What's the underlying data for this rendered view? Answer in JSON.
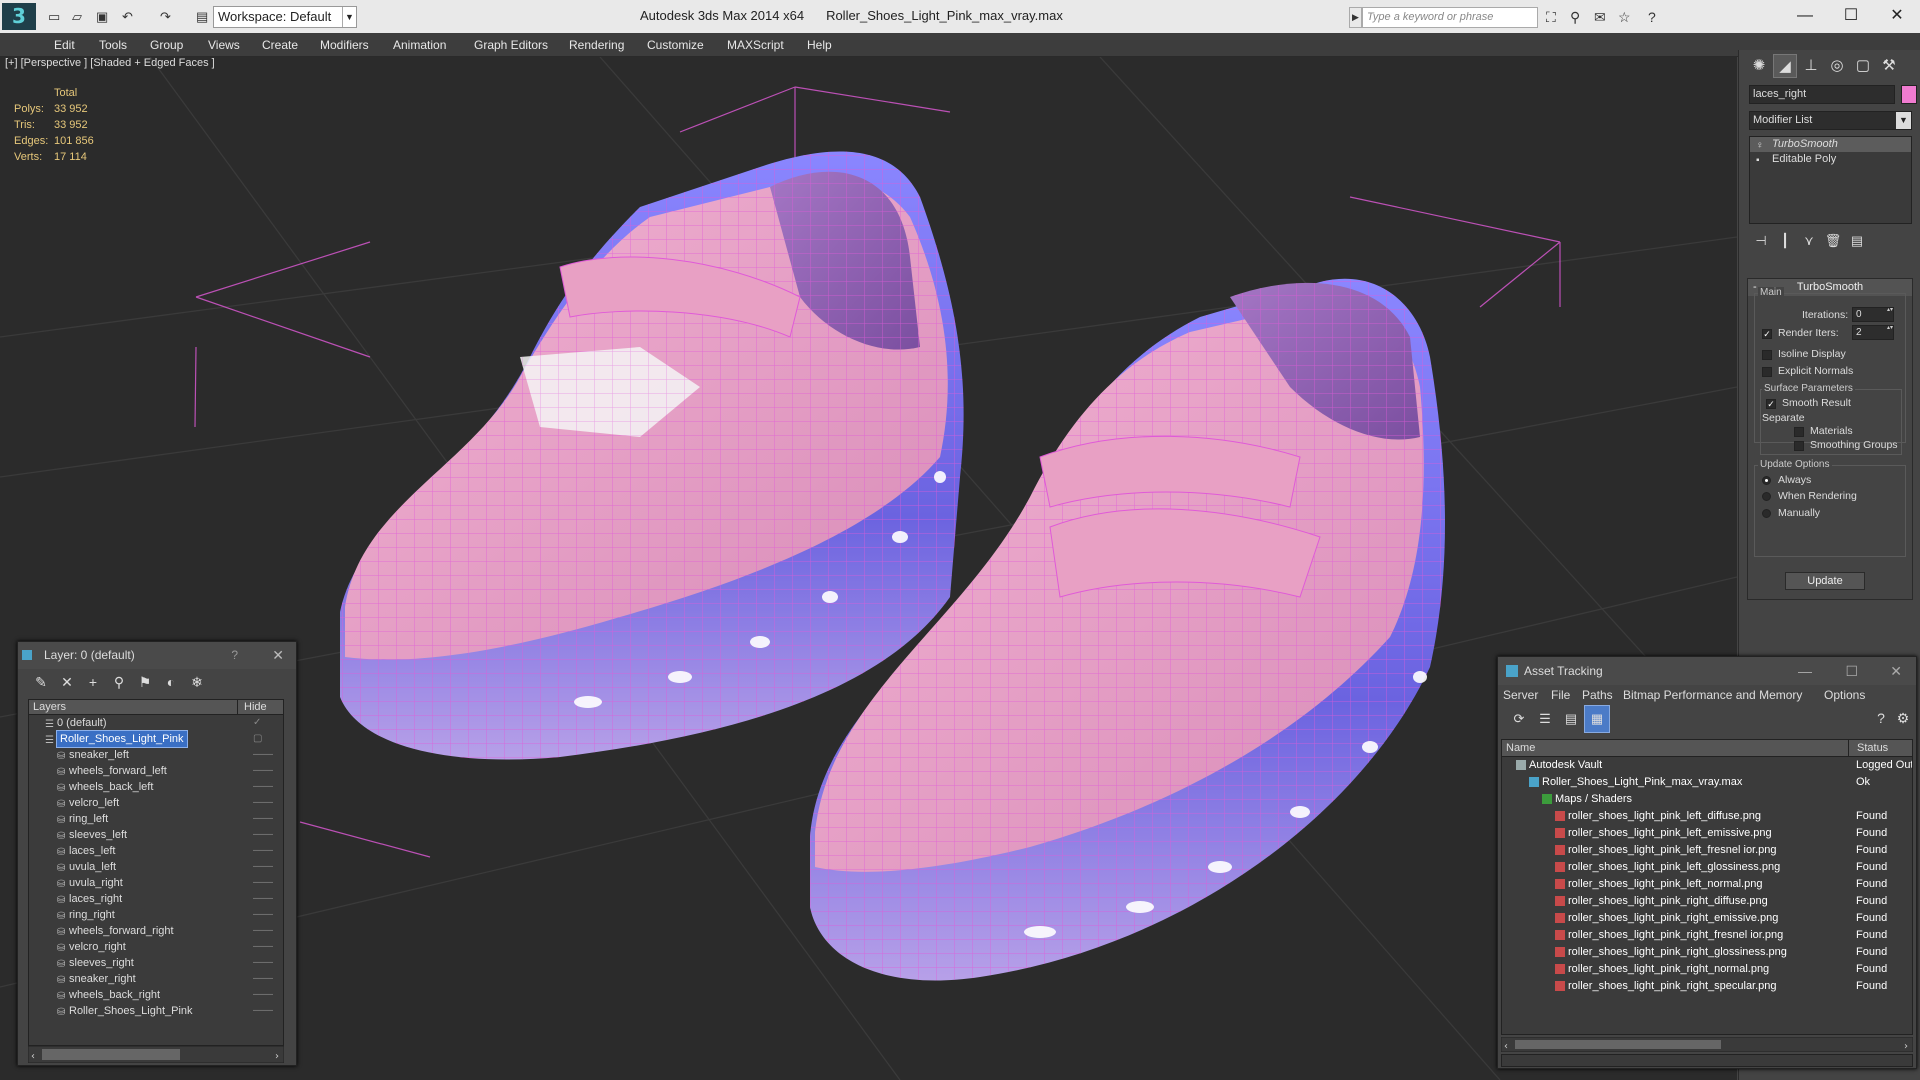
{
  "app": {
    "title": "Autodesk 3ds Max  2014 x64",
    "filename": "Roller_Shoes_Light_Pink_max_vray.max",
    "workspace": "Workspace: Default",
    "search_placeholder": "Type a keyword or phrase"
  },
  "menu": [
    "Edit",
    "Tools",
    "Group",
    "Views",
    "Create",
    "Modifiers",
    "Animation",
    "Graph Editors",
    "Rendering",
    "Customize",
    "MAXScript",
    "Help"
  ],
  "viewport": {
    "label": "[+] [Perspective ] [Shaded + Edged Faces ]",
    "stats": {
      "header": "Total",
      "rows": [
        {
          "k": "Polys:",
          "v": "33 952"
        },
        {
          "k": "Tris:",
          "v": "33 952"
        },
        {
          "k": "Edges:",
          "v": "101 856"
        },
        {
          "k": "Verts:",
          "v": "17 114"
        }
      ]
    }
  },
  "command_panel": {
    "object_name": "laces_right",
    "object_color": "#f07bd0",
    "modifier_list": "Modifier List",
    "stack": [
      {
        "label": "TurboSmooth",
        "selected": true
      },
      {
        "label": "Editable Poly",
        "selected": false
      }
    ],
    "rollout": {
      "title": "TurboSmooth",
      "main_label": "Main",
      "iterations_label": "Iterations:",
      "iterations_value": "0",
      "render_iters_label": "Render Iters:",
      "render_iters_value": "2",
      "render_iters_checked": true,
      "isoline": "Isoline Display",
      "explicit": "Explicit Normals",
      "surface_label": "Surface Parameters",
      "smooth_result": "Smooth Result",
      "separate_label": "Separate",
      "materials": "Materials",
      "smoothing_groups": "Smoothing Groups",
      "update_label": "Update Options",
      "always": "Always",
      "when_rendering": "When Rendering",
      "manually": "Manually",
      "update_button": "Update"
    }
  },
  "layer_window": {
    "title": "Layer: 0 (default)",
    "help": "?",
    "col_layers": "Layers",
    "col_hide": "Hide",
    "rows": [
      {
        "name": "0 (default)",
        "level": 0,
        "selected": false,
        "hide": "✓"
      },
      {
        "name": "Roller_Shoes_Light_Pink",
        "level": 0,
        "selected": true,
        "hide": "▢"
      },
      {
        "name": "sneaker_left",
        "level": 1,
        "selected": false,
        "hide": "——"
      },
      {
        "name": "wheels_forward_left",
        "level": 1,
        "selected": false,
        "hide": "——"
      },
      {
        "name": "wheels_back_left",
        "level": 1,
        "selected": false,
        "hide": "——"
      },
      {
        "name": "velcro_left",
        "level": 1,
        "selected": false,
        "hide": "——"
      },
      {
        "name": "ring_left",
        "level": 1,
        "selected": false,
        "hide": "——"
      },
      {
        "name": "sleeves_left",
        "level": 1,
        "selected": false,
        "hide": "——"
      },
      {
        "name": "laces_left",
        "level": 1,
        "selected": false,
        "hide": "——"
      },
      {
        "name": "uvula_left",
        "level": 1,
        "selected": false,
        "hide": "——"
      },
      {
        "name": "uvula_right",
        "level": 1,
        "selected": false,
        "hide": "——"
      },
      {
        "name": "laces_right",
        "level": 1,
        "selected": false,
        "hide": "——"
      },
      {
        "name": "ring_right",
        "level": 1,
        "selected": false,
        "hide": "——"
      },
      {
        "name": "wheels_forward_right",
        "level": 1,
        "selected": false,
        "hide": "——"
      },
      {
        "name": "velcro_right",
        "level": 1,
        "selected": false,
        "hide": "——"
      },
      {
        "name": "sleeves_right",
        "level": 1,
        "selected": false,
        "hide": "——"
      },
      {
        "name": "sneaker_right",
        "level": 1,
        "selected": false,
        "hide": "——"
      },
      {
        "name": "wheels_back_right",
        "level": 1,
        "selected": false,
        "hide": "——"
      },
      {
        "name": "Roller_Shoes_Light_Pink",
        "level": 1,
        "selected": false,
        "hide": "——"
      }
    ]
  },
  "asset_window": {
    "title": "Asset Tracking",
    "menu": [
      "Server",
      "File",
      "Paths",
      "Bitmap Performance and Memory",
      "Options"
    ],
    "col_name": "Name",
    "col_status": "Status",
    "rows": [
      {
        "name": "Autodesk Vault",
        "level": 0,
        "status": "Logged Out",
        "icon": "vault-icon"
      },
      {
        "name": "Roller_Shoes_Light_Pink_max_vray.max",
        "level": 1,
        "status": "Ok",
        "icon": "max-file-icon"
      },
      {
        "name": "Maps / Shaders",
        "level": 2,
        "status": "",
        "icon": "maps-icon"
      },
      {
        "name": "roller_shoes_light_pink_left_diffuse.png",
        "level": 3,
        "status": "Found",
        "icon": "png-icon"
      },
      {
        "name": "roller_shoes_light_pink_left_emissive.png",
        "level": 3,
        "status": "Found",
        "icon": "png-icon"
      },
      {
        "name": "roller_shoes_light_pink_left_fresnel ior.png",
        "level": 3,
        "status": "Found",
        "icon": "png-icon"
      },
      {
        "name": "roller_shoes_light_pink_left_glossiness.png",
        "level": 3,
        "status": "Found",
        "icon": "png-icon"
      },
      {
        "name": "roller_shoes_light_pink_left_normal.png",
        "level": 3,
        "status": "Found",
        "icon": "png-icon"
      },
      {
        "name": "roller_shoes_light_pink_right_diffuse.png",
        "level": 3,
        "status": "Found",
        "icon": "png-icon"
      },
      {
        "name": "roller_shoes_light_pink_right_emissive.png",
        "level": 3,
        "status": "Found",
        "icon": "png-icon"
      },
      {
        "name": "roller_shoes_light_pink_right_fresnel ior.png",
        "level": 3,
        "status": "Found",
        "icon": "png-icon"
      },
      {
        "name": "roller_shoes_light_pink_right_glossiness.png",
        "level": 3,
        "status": "Found",
        "icon": "png-icon"
      },
      {
        "name": "roller_shoes_light_pink_right_normal.png",
        "level": 3,
        "status": "Found",
        "icon": "png-icon"
      },
      {
        "name": "roller_shoes_light_pink_right_specular.png",
        "level": 3,
        "status": "Found",
        "icon": "png-icon"
      }
    ]
  },
  "colors": {
    "wire": "#e05ad8",
    "shoe_pink": "#e9a6c8",
    "sole_blue": "#7a73e6",
    "stats_yellow": "#e6c77a",
    "selection_blue": "#3a6fc4"
  }
}
